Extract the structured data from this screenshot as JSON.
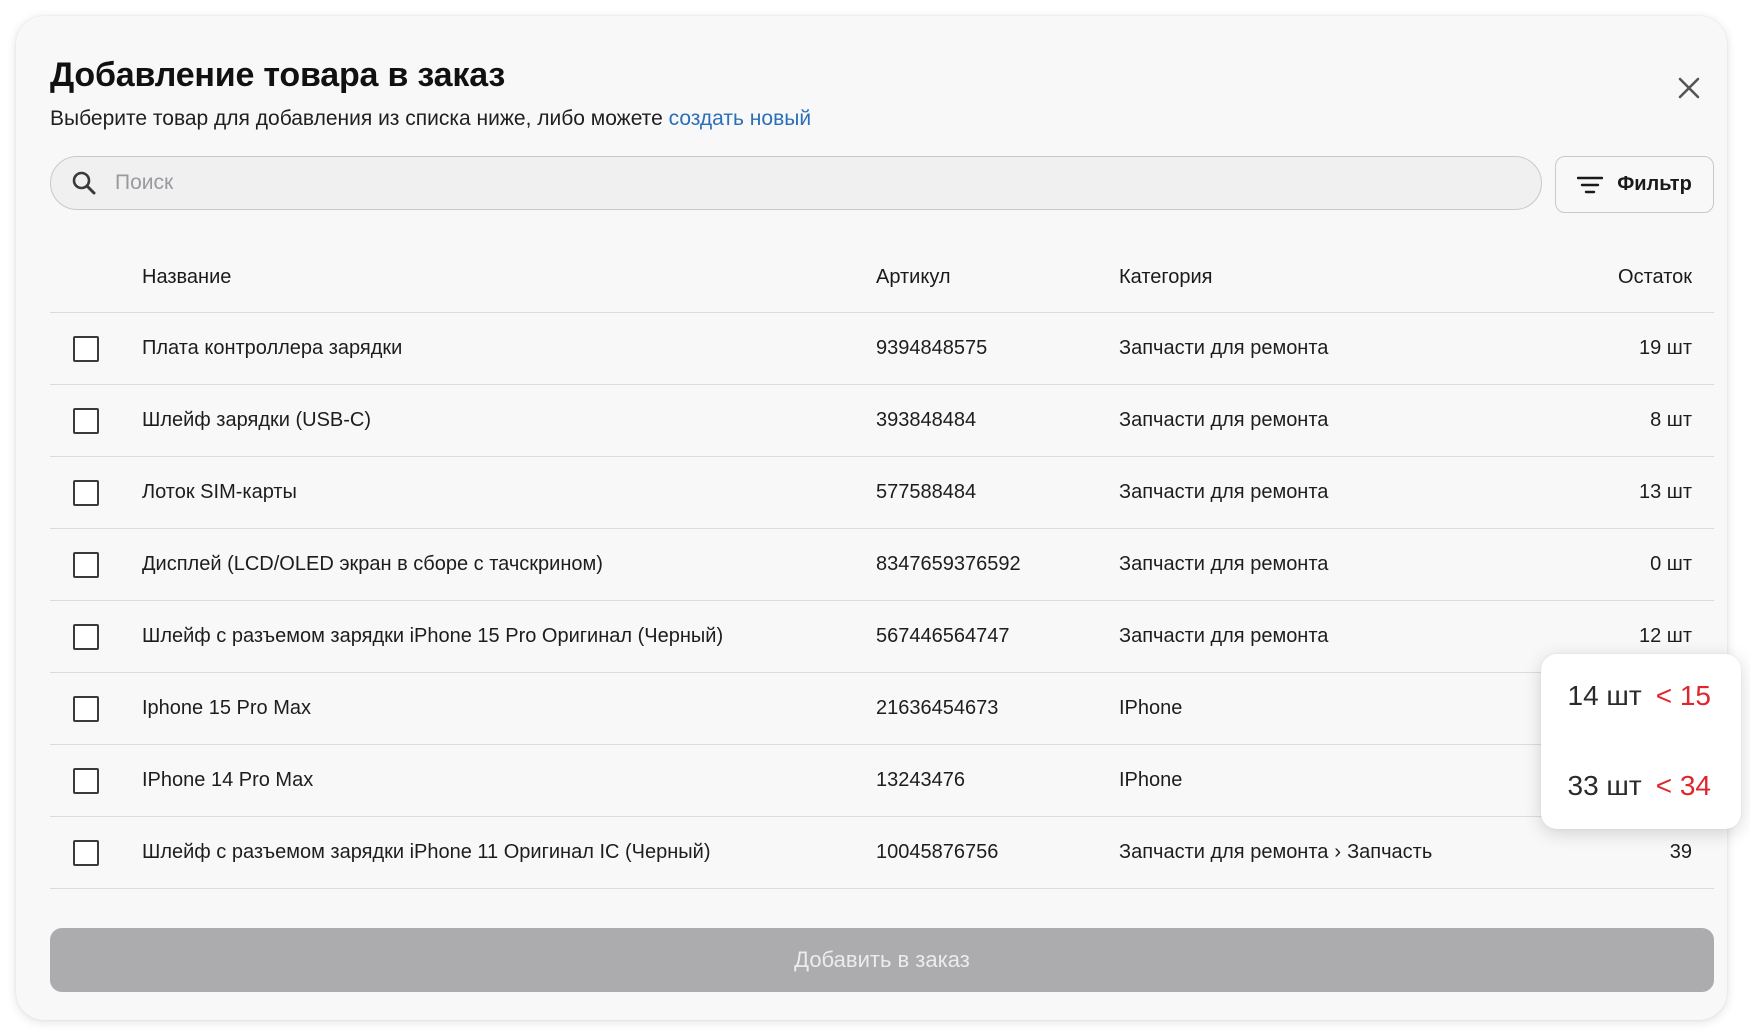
{
  "dialog": {
    "title": "Добавление товара в заказ",
    "subtitle_prefix": "Выберите товар для добавления из списка ниже, либо можете ",
    "subtitle_link": "создать новый",
    "close_icon": "close-icon"
  },
  "search": {
    "placeholder": "Поиск",
    "value": "",
    "icon": "search-icon"
  },
  "filter": {
    "label": "Фильтр",
    "icon": "filter-icon"
  },
  "table": {
    "headers": {
      "name": "Название",
      "sku": "Артикул",
      "category": "Категория",
      "stock": "Остаток"
    },
    "rows": [
      {
        "name": "Плата контроллера зарядки",
        "sku": "9394848575",
        "category": "Запчасти для ремонта",
        "subcategory": "",
        "stock": "19 шт"
      },
      {
        "name": "Шлейф зарядки (USB-C)",
        "sku": "393848484",
        "category": "Запчасти для ремонта",
        "subcategory": "",
        "stock": "8 шт"
      },
      {
        "name": "Лоток SIM-карты",
        "sku": "577588484",
        "category": "Запчасти для ремонта",
        "subcategory": "",
        "stock": "13 шт"
      },
      {
        "name": "Дисплей (LCD/OLED экран в сборе с тачскрином)",
        "sku": "8347659376592",
        "category": "Запчасти для ремонта",
        "subcategory": "",
        "stock": "0 шт"
      },
      {
        "name": "Шлейф с разъемом зарядки iPhone 15 Pro Оригинал (Черный)",
        "sku": "567446564747",
        "category": "Запчасти для ремонта",
        "subcategory": "",
        "stock": "12 шт"
      },
      {
        "name": "Iphone 15 Pro Max",
        "sku": "21636454673",
        "category": "IPhone",
        "subcategory": "",
        "stock": ""
      },
      {
        "name": "IPhone 14 Pro Max",
        "sku": "13243476",
        "category": "IPhone",
        "subcategory": "",
        "stock": ""
      },
      {
        "name": "Шлейф с разъемом зарядки iPhone 11 Оригинал IC (Черный)",
        "sku": "10045876756",
        "category": "Запчасти для ремонта",
        "subcategory": "Запчасть",
        "category_separator": "›",
        "stock": "39"
      }
    ]
  },
  "stock_popover": {
    "items": [
      {
        "qty": "14 шт",
        "limit": "< 15"
      },
      {
        "qty": "33 шт",
        "limit": "< 34"
      }
    ],
    "limit_color": "#e0262b"
  },
  "add_button": {
    "label": "Добавить в заказ",
    "disabled": true
  },
  "colors": {
    "link": "#2a6fb8",
    "button_disabled": "#acacae"
  }
}
